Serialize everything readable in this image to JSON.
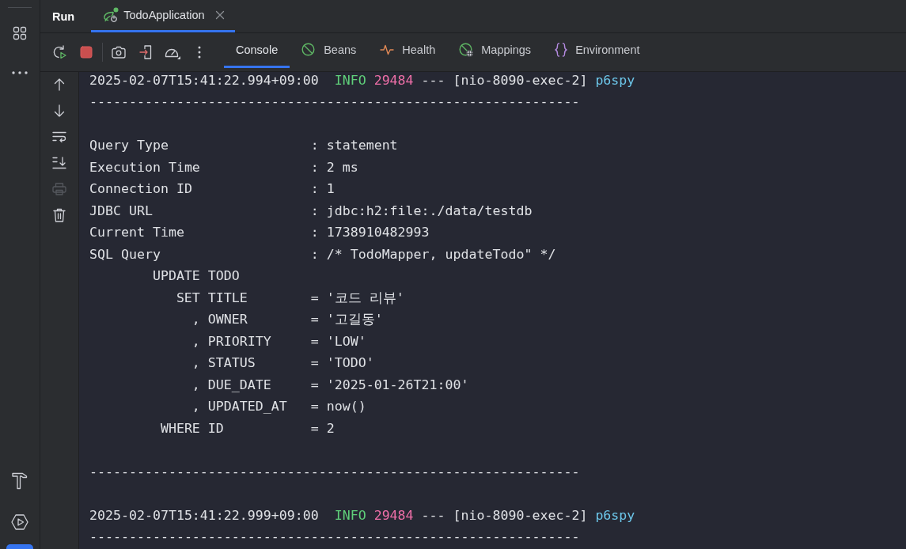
{
  "run_panel": {
    "title": "Run",
    "tabs": [
      {
        "label": "TodoApplication",
        "selected": true
      }
    ]
  },
  "service_tabs": [
    {
      "label": "Console",
      "selected": true
    },
    {
      "label": "Beans",
      "selected": false
    },
    {
      "label": "Health",
      "selected": false
    },
    {
      "label": "Mappings",
      "selected": false
    },
    {
      "label": "Environment",
      "selected": false
    }
  ],
  "console_actions": [
    {
      "disabled": false
    },
    {
      "disabled": false
    },
    {
      "disabled": false
    },
    {
      "disabled": false
    },
    {
      "disabled": true
    },
    {
      "disabled": false
    }
  ],
  "console": {
    "lines": [
      {
        "kind": "log",
        "timestamp": "2025-02-07T15:41:22.994+09:00",
        "level": "INFO",
        "pid": "29484",
        "separator": "---",
        "thread": "[nio-8090-exec-2]",
        "logger": "p6spy"
      },
      {
        "kind": "rule",
        "text": "--------------------------------------------------------------"
      },
      {
        "kind": "blank"
      },
      {
        "kind": "field",
        "key": "Query Type",
        "value": ": statement"
      },
      {
        "kind": "field",
        "key": "Execution Time",
        "value": ": 2 ms"
      },
      {
        "kind": "field",
        "key": "Connection ID",
        "value": ": 1"
      },
      {
        "kind": "field",
        "key": "JDBC URL",
        "value": ": jdbc:h2:file:./data/testdb"
      },
      {
        "kind": "field",
        "key": "Current Time",
        "value": ": 1738910482993"
      },
      {
        "kind": "field",
        "key": "SQL Query",
        "value": ": /* TodoMapper, updateTodo\" */"
      },
      {
        "kind": "sql",
        "keyword": "UPDATE",
        "column": "TODO"
      },
      {
        "kind": "sql",
        "keyword": "SET",
        "column": "TITLE",
        "value": "= '코드 리뷰'"
      },
      {
        "kind": "sql",
        "keyword": ",",
        "column": "OWNER",
        "value": "= '고길동'"
      },
      {
        "kind": "sql",
        "keyword": ",",
        "column": "PRIORITY",
        "value": "= 'LOW'"
      },
      {
        "kind": "sql",
        "keyword": ",",
        "column": "STATUS",
        "value": "= 'TODO'"
      },
      {
        "kind": "sql",
        "keyword": ",",
        "column": "DUE_DATE",
        "value": "= '2025-01-26T21:00'"
      },
      {
        "kind": "sql",
        "keyword": ",",
        "column": "UPDATED_AT",
        "value": "= now()"
      },
      {
        "kind": "sql",
        "keyword": "WHERE",
        "column": "ID",
        "value": "= 2"
      },
      {
        "kind": "blank"
      },
      {
        "kind": "rule",
        "text": "--------------------------------------------------------------"
      },
      {
        "kind": "blank"
      },
      {
        "kind": "log",
        "timestamp": "2025-02-07T15:41:22.999+09:00",
        "level": "INFO",
        "pid": "29484",
        "separator": "---",
        "thread": "[nio-8090-exec-2]",
        "logger": "p6spy"
      },
      {
        "kind": "rule",
        "text": "--------------------------------------------------------------"
      }
    ]
  }
}
